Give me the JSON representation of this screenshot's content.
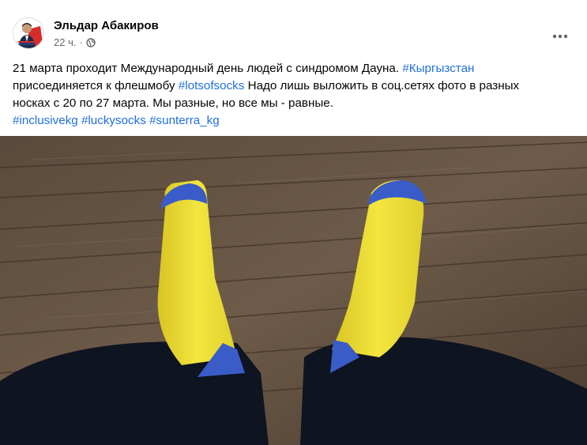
{
  "post": {
    "author": "Эльдар Абакиров",
    "time": "22 ч.",
    "separator": "·",
    "privacy_icon": "globe-icon",
    "menu_icon": "more-options-icon",
    "text": {
      "line1_prefix": "21 марта проходит Международный день людей с синдромом Дауна. ",
      "tag_kyrgyzstan": "#Кыргызстан",
      "line2_prefix": "присоединяется к флешмобу ",
      "tag_lotsofsocks": "#lotsofsocks",
      "line2_suffix": " Надо лишь выложить в соц.сетях фото в разных",
      "line3": "носках с 20 по 27 марта. Мы разные, но все мы - равные.",
      "tag_inclusivekg": "#inclusivekg",
      "tag_luckysocks": "#luckysocks",
      "tag_sunterra": "#sunterra_kg"
    }
  },
  "colors": {
    "link": "#216fdb",
    "text": "#050505",
    "secondary": "#65676b",
    "sock_yellow": "#f2e63a",
    "sock_blue": "#3a5cc8"
  }
}
